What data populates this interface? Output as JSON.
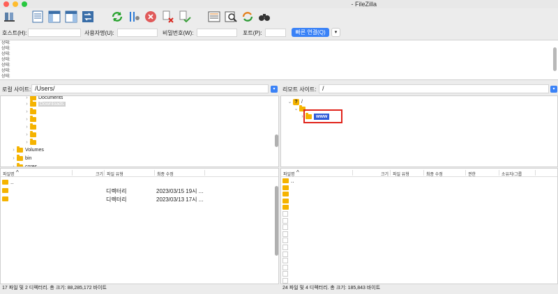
{
  "window": {
    "title": "- FileZilla"
  },
  "toolbar": {
    "icons": [
      "site-manager-icon",
      "toggle-log-icon",
      "toggle-local-tree-icon",
      "toggle-remote-tree-icon",
      "transfer-queue-icon",
      "refresh-icon",
      "process-queue-icon",
      "cancel-icon",
      "disconnect-icon",
      "reconnect-icon",
      "filter-icon",
      "compare-icon",
      "sync-browse-icon",
      "find-icon"
    ]
  },
  "quickconnect": {
    "host_label": "호스트(H):",
    "user_label": "사용자명(U):",
    "pass_label": "비밀번호(W):",
    "port_label": "포트(P):",
    "connect_label": "빠른 연결(Q)",
    "dropdown": "▾"
  },
  "log": {
    "lines": [
      "상태:",
      "상태:",
      "상태:",
      "상태:",
      "상태:",
      "상태:",
      "상태:"
    ]
  },
  "local": {
    "site_label": "로컬 사이트:",
    "path": "/Users/",
    "tree": [
      {
        "label": "Documents",
        "expanded": false
      },
      {
        "label": "Downloads",
        "expanded": false,
        "selected": true
      },
      {
        "label": "",
        "expanded": false
      },
      {
        "label": "",
        "expanded": false
      },
      {
        "label": "",
        "expanded": false
      },
      {
        "label": "",
        "expanded": false
      },
      {
        "label": "",
        "expanded": false
      },
      {
        "label": "Volumes",
        "expanded": false
      },
      {
        "label": "bin",
        "expanded": false
      },
      {
        "label": "cores",
        "expanded": false
      }
    ],
    "columns": [
      "파일명",
      "크기",
      "파일 유형",
      "최종 수정"
    ],
    "rows": [
      {
        "name": "..",
        "size": "",
        "type": "",
        "modified": ""
      },
      {
        "name": "",
        "size": "",
        "type": "디렉터리",
        "modified": "2023/03/15 19시 ..."
      },
      {
        "name": "",
        "size": "",
        "type": "디렉터리",
        "modified": "2023/03/13 17시 ..."
      }
    ],
    "status": "17 파일 및 2 디렉터리. 총 크기: 88,285,172 바이트"
  },
  "remote": {
    "site_label": "리모트 사이트:",
    "path": "/",
    "tree": [
      {
        "label": "/",
        "expanded": true
      },
      {
        "label": "",
        "expanded": true
      },
      {
        "label": "www",
        "expanded": false,
        "selected": true
      }
    ],
    "columns": [
      "파일명",
      "크기",
      "파일 유형",
      "최종 수정",
      "권한",
      "소유자/그룹"
    ],
    "rows": [
      {
        "name": "..",
        "type": "folder"
      },
      {
        "name": "",
        "type": "folder"
      },
      {
        "name": "",
        "type": "folder"
      },
      {
        "name": "",
        "type": "folder"
      },
      {
        "name": "",
        "type": "folder"
      },
      {
        "name": "",
        "type": "file"
      },
      {
        "name": "",
        "type": "file"
      },
      {
        "name": "",
        "type": "file"
      },
      {
        "name": "",
        "type": "file"
      },
      {
        "name": "",
        "type": "file"
      },
      {
        "name": "",
        "type": "file"
      },
      {
        "name": "",
        "type": "file"
      },
      {
        "name": "",
        "type": "file"
      },
      {
        "name": "",
        "type": "file"
      },
      {
        "name": "",
        "type": "file"
      },
      {
        "name": "",
        "type": "file"
      }
    ],
    "status": "24 파일 및 4 디렉터리. 총 크기: 185,843 바이트"
  },
  "colors": {
    "accent": "#3a82f7",
    "highlight_box": "#e0231a",
    "folder": "#f5b300"
  }
}
